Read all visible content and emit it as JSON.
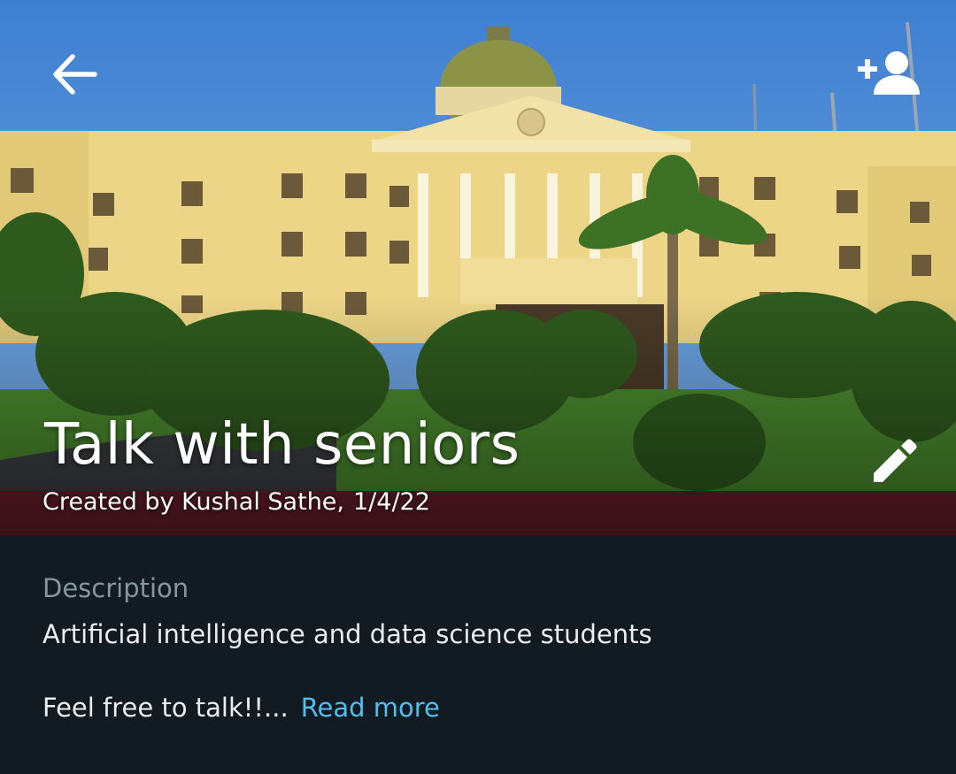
{
  "header": {
    "back_icon": "arrow-back-icon",
    "add_member_icon": "person-add-icon",
    "edit_icon": "pencil-icon"
  },
  "group": {
    "name": "Talk with seniors",
    "created_by": "Created by Kushal Sathe,",
    "created_date": "1/4/22"
  },
  "description": {
    "label": "Description",
    "line1": "Artificial intelligence and data science students",
    "line2": "Feel free to talk!!...",
    "read_more": "Read more"
  },
  "colors": {
    "background": "#121b22",
    "link": "#53bdeb",
    "muted": "#8696a0",
    "text": "#e9edef"
  }
}
